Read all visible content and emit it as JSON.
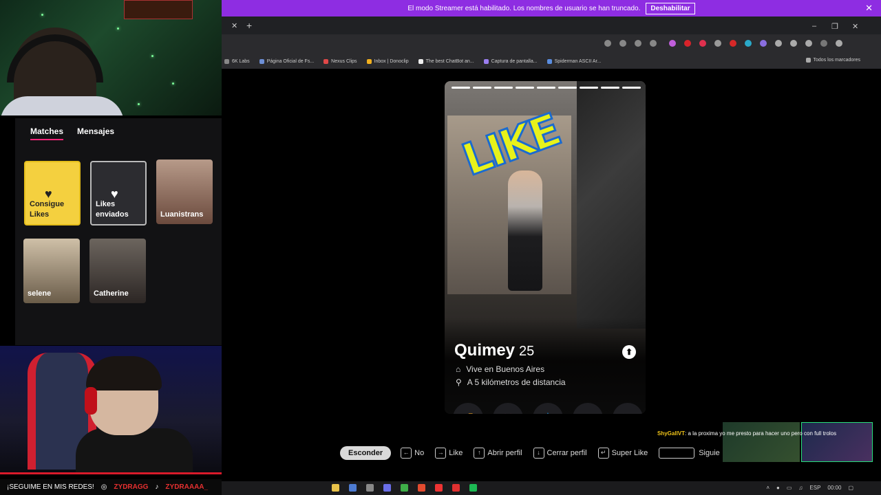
{
  "streamer_banner": {
    "message": "El modo Streamer está habilitado. Los nombres de usuario se han truncado.",
    "disable_label": "Deshabilitar",
    "close_glyph": "✕"
  },
  "browser": {
    "tab_close_glyph": "✕",
    "new_tab_glyph": "+",
    "minimize_glyph": "–",
    "maximize_glyph": "❐",
    "close_glyph": "✕",
    "bookmarks": [
      "6K Labs",
      "Página Oficial de Fs...",
      "Nexus Clips",
      "Inbox | Donoclip",
      "The best ChatBot an...",
      "Captura de pantalla...",
      "Spiderman ASCII Ar..."
    ],
    "all_bookmarks": "Todos los marcadores"
  },
  "sidebar": {
    "tabs": [
      "Matches",
      "Mensajes"
    ],
    "cards": {
      "get_likes": "Consigue Likes",
      "likes_sent": "Likes enviados",
      "luan": "Luanistrans",
      "selene": "selene",
      "catherine": "Catherine"
    }
  },
  "profile": {
    "stamp": "LIKE",
    "name": "Quimey",
    "age": "25",
    "location": "Vive en Buenos Aires",
    "distance": "A 5 kilómetros de distancia",
    "photo_count": 9,
    "active_photo": 1,
    "info_glyph": "⬆"
  },
  "actions": {
    "rewind": "↺",
    "nope": "✕",
    "superlike": "★",
    "like": "♥",
    "boost": "➤",
    "colors": {
      "rewind": "#f5a623",
      "nope": "#fd267a",
      "superlike": "#1ca4f2",
      "like": "#1fcb72",
      "boost": "#3ea0f0"
    }
  },
  "shortcuts": {
    "hide": "Esconder",
    "no": "No",
    "like": "Like",
    "open": "Abrir perfil",
    "close": "Cerrar perfil",
    "super": "Super Like",
    "next": "Siguie"
  },
  "chat": {
    "user": "ShyGallVT",
    "message": ": a la proxima yo me presto para hacer uno pero con full trolos"
  },
  "social": {
    "text": "¡SEGUIME EN MIS REDES!",
    "ig": "ZYDRAGG",
    "tiktok": "ZYDRAAAA_"
  },
  "taskbar": {
    "lang": "ESP",
    "time": "00:00"
  }
}
